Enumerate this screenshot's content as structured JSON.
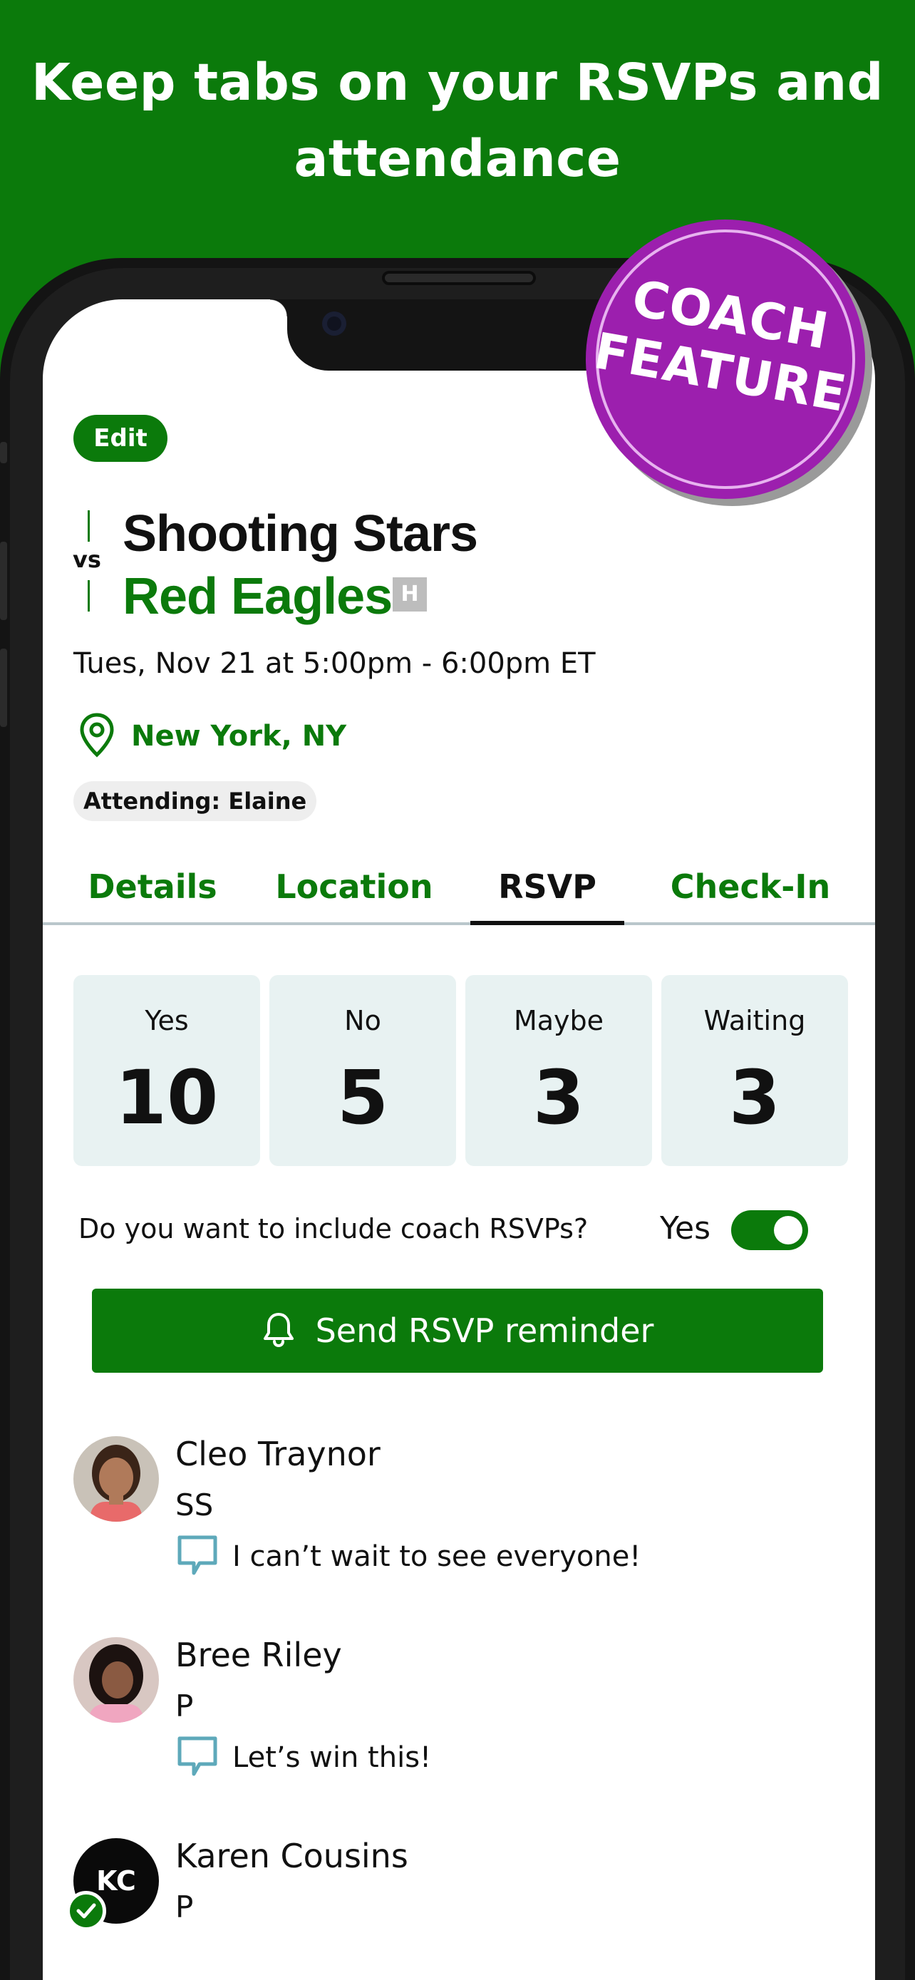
{
  "headline": {
    "line1": "Keep tabs on your RSVPs and",
    "line2": "attendance"
  },
  "badge": {
    "line1": "COACH",
    "line2": "FEATURE"
  },
  "event": {
    "edit_label": "Edit",
    "vs_label": "vs",
    "home_team": "Shooting Stars",
    "away_team": "Red Eagles",
    "home_away_tag": "H",
    "datetime": "Tues, Nov 21 at 5:00pm - 6:00pm ET",
    "location": "New York, NY",
    "attending": "Attending: Elaine"
  },
  "tabs": [
    {
      "label": "Details"
    },
    {
      "label": "Location"
    },
    {
      "label": "RSVP"
    },
    {
      "label": "Check-In"
    }
  ],
  "stats": [
    {
      "label": "Yes",
      "value": "10"
    },
    {
      "label": "No",
      "value": "5"
    },
    {
      "label": "Maybe",
      "value": "3"
    },
    {
      "label": "Waiting",
      "value": "3"
    }
  ],
  "coach_rsvp": {
    "question": "Do you want to include coach RSVPs?",
    "toggle_label": "Yes",
    "toggle_on": true
  },
  "reminder_button": "Send RSVP reminder",
  "members": [
    {
      "name": "Cleo Traynor",
      "position": "SS",
      "note": "I can’t wait to see everyone!"
    },
    {
      "name": "Bree Riley",
      "position": "P",
      "note": "Let’s win this!"
    },
    {
      "name": "Karen Cousins",
      "position": "P",
      "initials": "KC"
    }
  ],
  "colors": {
    "brand_green": "#0b7a0b",
    "badge_purple": "#9c1fae",
    "stat_bg": "#e8f2f2"
  }
}
